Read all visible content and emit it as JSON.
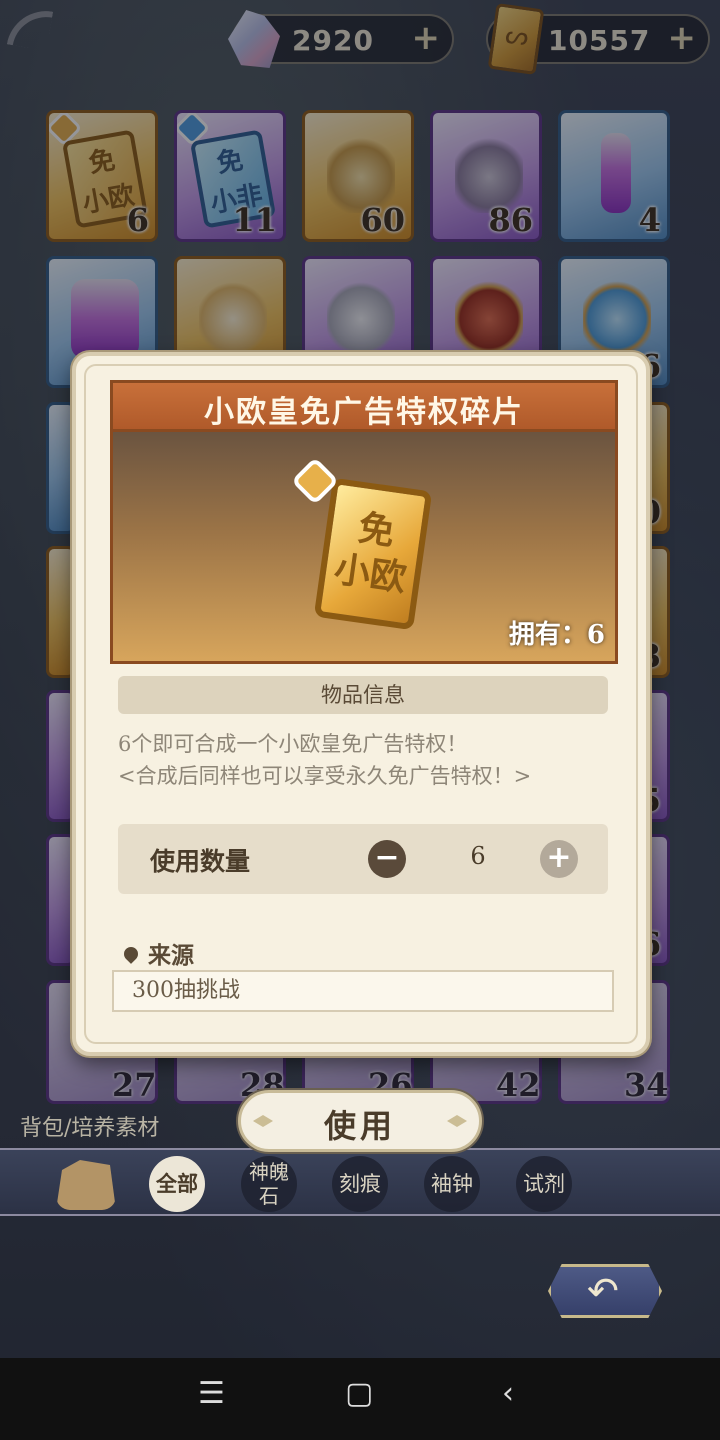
{
  "currencies": [
    {
      "icon": "crystal-icon",
      "value": "2920",
      "plus": "+"
    },
    {
      "icon": "ticket-icon",
      "value": "10557",
      "plus": "+"
    }
  ],
  "grid": {
    "row1": [
      {
        "count": "6",
        "label": "免\n小欧"
      },
      {
        "count": "11",
        "label": "免\n小非"
      },
      {
        "count": "60"
      },
      {
        "count": "86"
      },
      {
        "count": "4"
      }
    ],
    "right_edge_counts": [
      "6",
      "0",
      "3",
      "5",
      "6"
    ],
    "bottom_counts": [
      "27",
      "28",
      "26",
      "42",
      "34"
    ]
  },
  "breadcrumb": "背包/培养素材",
  "tabs": [
    {
      "label": "全部",
      "active": true
    },
    {
      "label": "神魄石"
    },
    {
      "label": "刻痕"
    },
    {
      "label": "袖钟"
    },
    {
      "label": "试剂"
    }
  ],
  "tab_neighbor": {
    "line1": "神魄",
    "line2": "石"
  },
  "modal": {
    "title": "小欧皇免广告特权碎片",
    "ticket_text_1": "免",
    "ticket_text_2": "小欧",
    "owned": "拥有：6",
    "section_title": "物品信息",
    "desc_line1": "6个即可合成一个小欧皇免广告特权！",
    "desc_line2": "<合成后同样也可以享受永久免广告特权！>",
    "qty_label": "使用数量",
    "qty_value": "6",
    "minus": "−",
    "plus": "+",
    "source_title": "来源",
    "source_item": "300抽挑战"
  },
  "use_button": "使用",
  "return_button": "↶",
  "sysnav": {
    "menu": "☰",
    "home": "▢",
    "back": "‹"
  }
}
